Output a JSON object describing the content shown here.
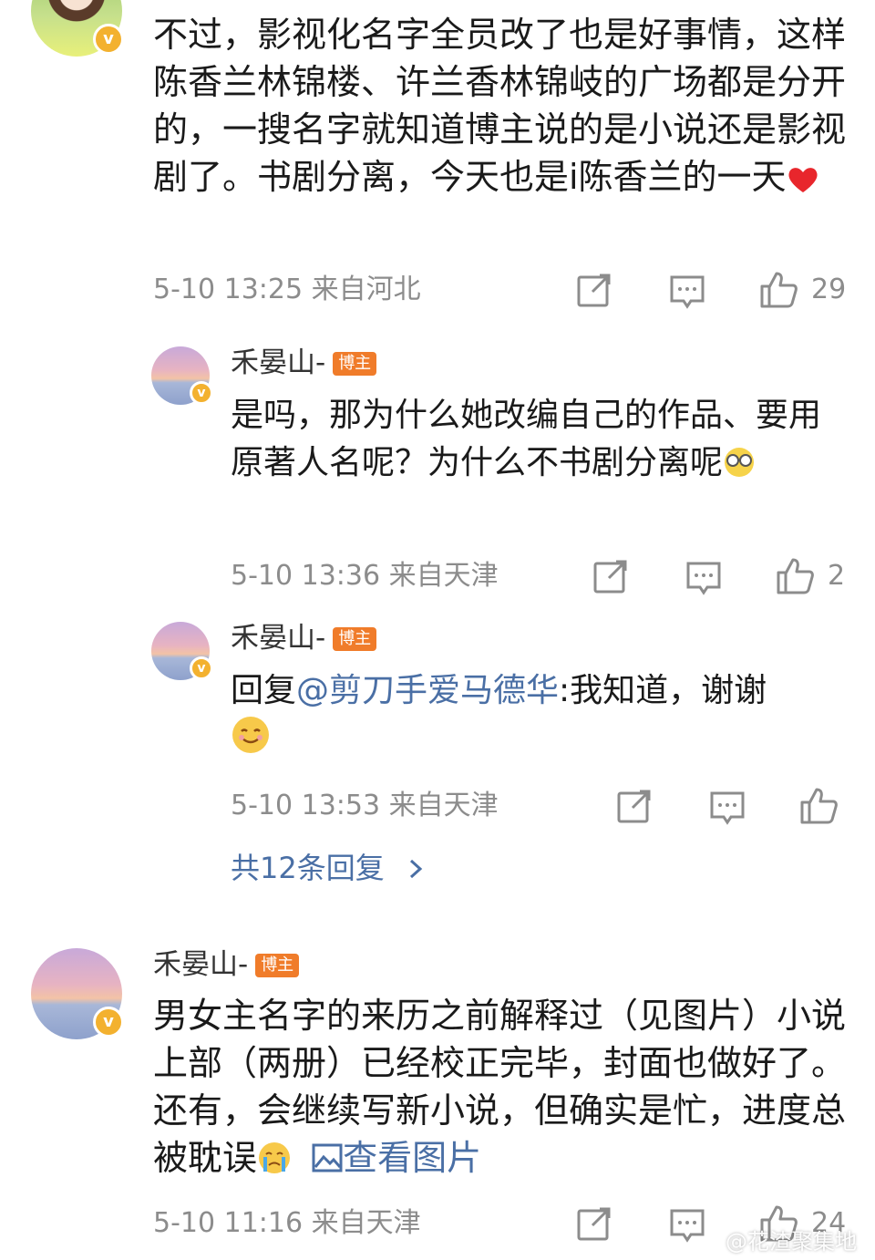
{
  "comment1": {
    "text": "不过，影视化名字全员改了也是好事情，这样陈香兰林锦楼、许兰香林锦岐的广场都是分开的，一搜名字就知道博主说的是小说还是影视剧了。书剧分离，今天也是i陈香兰的一天",
    "time": "5-10 13:25",
    "location": "来自河北",
    "likes": "29"
  },
  "reply1": {
    "name": "禾晏山-",
    "badge": "博主",
    "text": "是吗，那为什么她改编自己的作品、要用原著人名呢？为什么不书剧分离呢",
    "time": "5-10 13:36",
    "location": "来自天津",
    "likes": "2"
  },
  "reply2": {
    "name": "禾晏山-",
    "badge": "博主",
    "prefix": "回复",
    "mention": "@剪刀手爱马德华",
    "text": ":我知道，谢谢",
    "time": "5-10 13:53",
    "location": "来自天津"
  },
  "more_replies": "共12条回复",
  "comment2": {
    "name": "禾晏山-",
    "badge": "博主",
    "text": "男女主名字的来历之前解释过（见图片）小说上部（两册）已经校正完毕，封面也做好了。还有，会继续写新小说，但确实是忙，进度总被耽误",
    "view_image": "查看图片",
    "time": "5-10 11:16",
    "location": "来自天津",
    "likes": "24"
  },
  "watermark": "@花渣聚集地",
  "colors": {
    "link": "#4a6fa5",
    "meta": "#8c8c8c",
    "badge": "#f07c2a",
    "verified": "#f3b12f"
  }
}
